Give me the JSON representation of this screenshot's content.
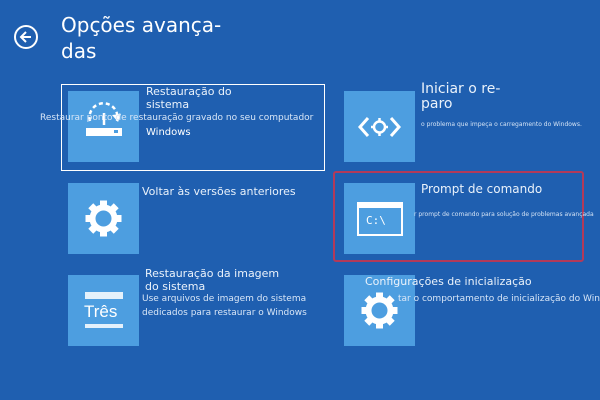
{
  "header": {
    "title": "Opções avança-das"
  },
  "options": [
    {
      "label": "Restauração do sistema",
      "description": "Restaurar ponto de restauração gravado no seu computador",
      "extra": "Windows",
      "icon": "restore-icon"
    },
    {
      "label": "Iniciar o re-paro",
      "description": "o problema que impeça o carregamento do Windows.",
      "icon": "code-brackets-icon"
    },
    {
      "label": "Voltar às versões anteriores",
      "description": "",
      "icon": "gear-icon"
    },
    {
      "label": "Prompt de comando",
      "description": "r prompt de comando para solução de problemas avançada",
      "icon": "command-prompt-icon",
      "icon_text": "C:\\"
    },
    {
      "label": "Restauração da imagem do sistema",
      "description": "Use arquivos de imagem do sistema dedicados para restaurar o Windows",
      "icon": "image-restore-icon",
      "icon_text": "Três"
    },
    {
      "label": "Configurações de inicialização",
      "description": "tar o comportamento de inicialização do Windows",
      "icon": "gear-icon"
    }
  ],
  "colors": {
    "background": "#1f5fb0",
    "tile": "#4d9ee0",
    "highlight": "#b23a5a"
  }
}
